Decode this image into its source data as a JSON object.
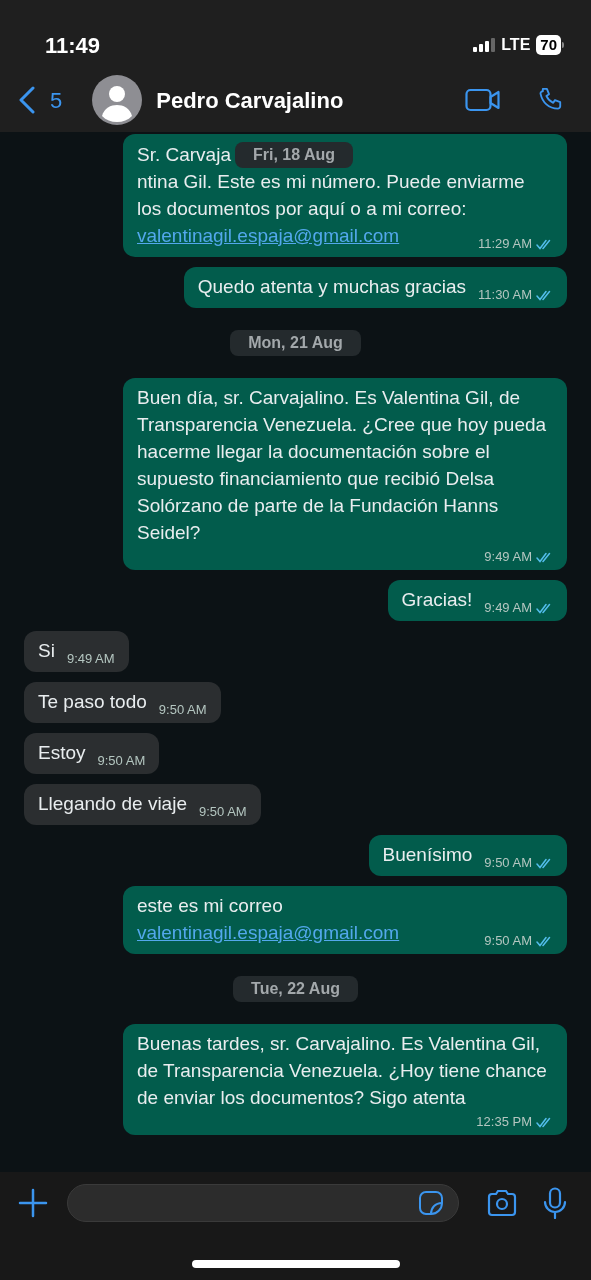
{
  "status_bar": {
    "time": "11:49",
    "network": "LTE",
    "battery": "70"
  },
  "header": {
    "back_count": "5",
    "contact_name": "Pedro Carvajalino"
  },
  "messages": [
    {
      "kind": "out",
      "text_start": "Sr. Carvaja",
      "floating_date": "Fri, 18 Aug",
      "text": "ntina Gil. Este es mi número. Puede enviarme los documentos por aquí o a mi correo:",
      "link": "valentinagil.espaja@gmail.com",
      "time": "11:29 AM",
      "read": true
    },
    {
      "kind": "out",
      "text": "Quedo atenta y muchas gracias",
      "time": "11:30 AM",
      "read": true
    },
    {
      "kind": "date",
      "text": "Mon, 21 Aug"
    },
    {
      "kind": "out",
      "text": "Buen día, sr. Carvajalino. Es Valentina Gil, de Transparencia Venezuela. ¿Cree que hoy pueda hacerme llegar la documentación sobre el supuesto financiamiento que recibió Delsa Solórzano de parte de la Fundación Hanns Seidel?",
      "time": "9:49 AM",
      "read": true
    },
    {
      "kind": "out",
      "text": "Gracias!",
      "time": "9:49 AM",
      "read": true
    },
    {
      "kind": "in",
      "text": "Si",
      "time": "9:49 AM"
    },
    {
      "kind": "in",
      "text": "Te paso todo",
      "time": "9:50 AM"
    },
    {
      "kind": "in",
      "text": "Estoy",
      "time": "9:50 AM"
    },
    {
      "kind": "in",
      "text": "Llegando de viaje",
      "time": "9:50 AM"
    },
    {
      "kind": "out",
      "text": "Buenísimo",
      "time": "9:50 AM",
      "read": true
    },
    {
      "kind": "out",
      "text": "este es mi correo",
      "link": "valentinagil.espaja@gmail.com",
      "time": "9:50 AM",
      "read": true
    },
    {
      "kind": "date",
      "text": "Tue, 22 Aug"
    },
    {
      "kind": "out",
      "text": "Buenas tardes, sr. Carvajalino. Es Valentina Gil, de Transparencia Venezuela. ¿Hoy tiene chance de enviar los documentos? Sigo atenta",
      "time": "12:35 PM",
      "read": true
    }
  ]
}
